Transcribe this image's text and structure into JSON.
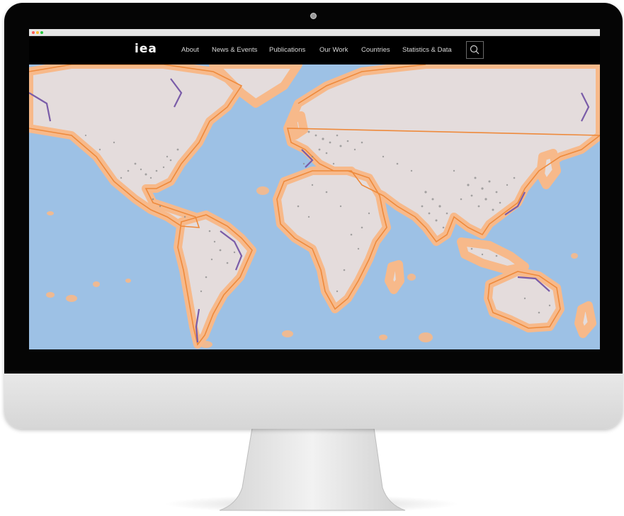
{
  "brand": {
    "logo_text": "iea"
  },
  "nav": {
    "items": [
      {
        "label": "About"
      },
      {
        "label": "News & Events"
      },
      {
        "label": "Publications"
      },
      {
        "label": "Our Work"
      },
      {
        "label": "Countries"
      },
      {
        "label": "Statistics & Data"
      }
    ],
    "search_icon": "search-icon"
  },
  "map": {
    "ocean_color": "#9dc1e5",
    "land_color": "#e4dcdc",
    "coastal_buffer_color": "#f7b98a",
    "coastline_color": "#ee8a3c",
    "boundary_color": "#7a5ca8",
    "point_color": "#8c8c8c"
  },
  "colors": {
    "bezel": "#050505",
    "chin": "#e0e0e0",
    "nav_background": "#000000",
    "nav_text": "#d8d8d8"
  }
}
